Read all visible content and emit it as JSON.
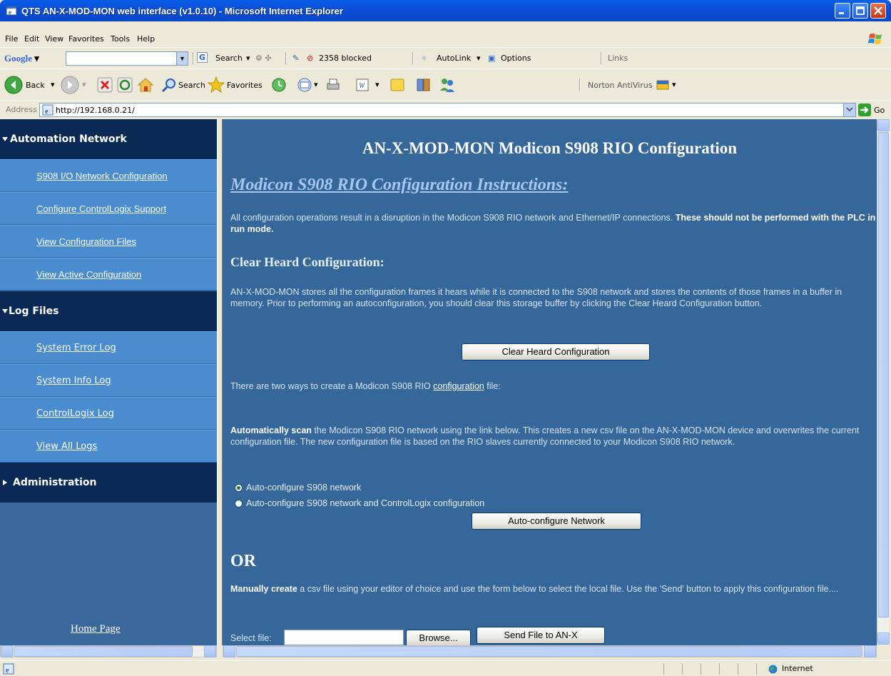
{
  "window": {
    "title": "QTS AN-X-MOD-MON web interface (v1.0.10) - Microsoft Internet Explorer"
  },
  "menubar": [
    "File",
    "Edit",
    "View",
    "Favorites",
    "Tools",
    "Help"
  ],
  "google_toolbar": {
    "logo": "Google",
    "search": "Search",
    "blocked": "2358 blocked",
    "autolink": "AutoLink",
    "options": "Options",
    "links": "Links"
  },
  "std_toolbar": {
    "back": "Back",
    "search": "Search",
    "favorites": "Favorites",
    "norton": "Norton AntiVirus"
  },
  "address": {
    "label": "Address",
    "url": "http://192.168.0.21/",
    "go": "Go"
  },
  "sidebar": {
    "sections": [
      {
        "label": "Automation Network",
        "items": [
          "S908 I/O Network Configuration",
          "Configure ControlLogix Support",
          "View Configuration Files",
          "View Active Configuration"
        ]
      },
      {
        "label": "Log Files",
        "items": [
          "System Error Log",
          "System Info Log",
          "ControlLogix Log",
          "View All Logs"
        ]
      },
      {
        "label": "Administration",
        "items": []
      }
    ],
    "home": "Home Page"
  },
  "main": {
    "title": "AN-X-MOD-MON Modicon S908 RIO Configuration",
    "instructions_title": "Modicon S908 RIO Configuration Instructions:",
    "intro_text": "All configuration operations result in a disruption in the Modicon S908 RIO network and Ethernet/IP connections. ",
    "intro_bold": "These should not be performed with the PLC in run mode.",
    "clear_heading": "Clear Heard Configuration:",
    "clear_text": "AN-X-MOD-MON stores all the configuration frames it hears while it is connected to the S908 network and stores the contents of those frames in a buffer in memory. Prior to performing an autoconfiguration, you should clear this storage buffer by clicking the Clear Heard Configuration button.",
    "clear_button": "Clear Heard Configuration",
    "two_ways_pre": "There are two ways to create a Modicon S908 RIO ",
    "two_ways_link": "configuration",
    "two_ways_post": " file:",
    "auto_bold": "Automatically scan",
    "auto_text": " the Modicon S908 RIO network using the link below. This creates a new csv file on the AN-X-MOD-MON device and overwrites the current configuration file. The new configuration file is based on the RIO slaves currently connected to your Modicon S908 RIO network.",
    "radio1": "Auto-configure S908 network",
    "radio2": "Auto-configure S908 network and ControlLogix configuration",
    "auto_button": "Auto-configure Network",
    "or": "OR",
    "manual_bold": "Manually create",
    "manual_text": " a csv file using your editor of choice and use the form below to select the local file. Use the 'Send' button to apply this configuration file....",
    "select_file": "Select file:",
    "browse": "Browse...",
    "send": "Send File to AN-X"
  },
  "status": {
    "zone": "Internet"
  }
}
